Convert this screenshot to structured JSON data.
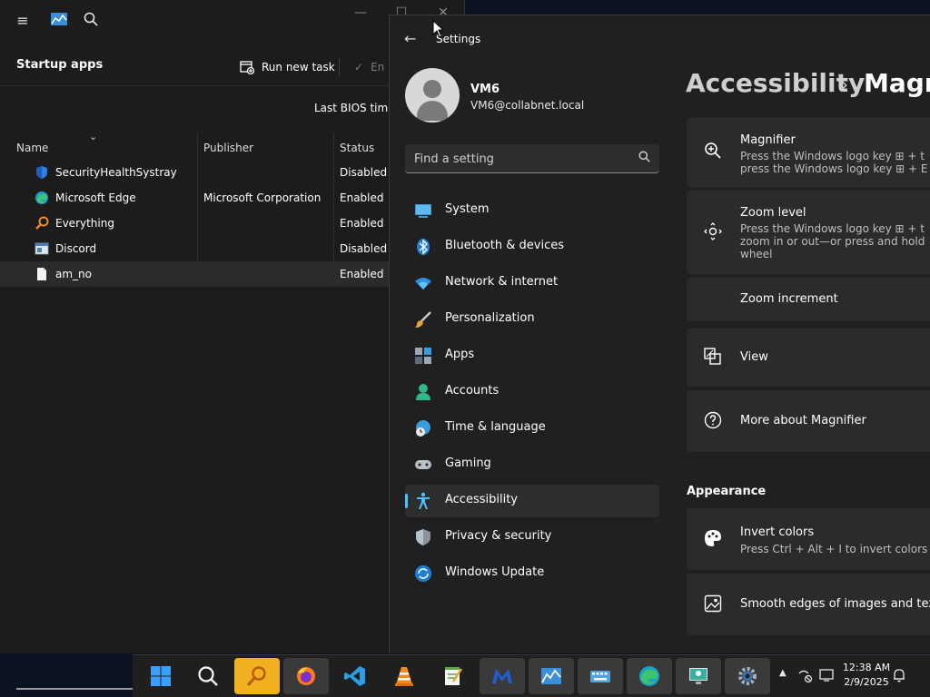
{
  "task_manager": {
    "page_title": "Startup apps",
    "run_new_task": "Run new task",
    "end_task": "En",
    "last_bios": "Last BIOS time:",
    "columns": [
      "Name",
      "Publisher",
      "Status"
    ],
    "rows": [
      {
        "name": "SecurityHealthSystray",
        "publisher": "",
        "status": "Disabled",
        "icon": "shield-icon"
      },
      {
        "name": "Microsoft Edge",
        "publisher": "Microsoft Corporation",
        "status": "Enabled",
        "icon": "edge-icon"
      },
      {
        "name": "Everything",
        "publisher": "",
        "status": "Enabled",
        "icon": "magnifier-icon"
      },
      {
        "name": "Discord",
        "publisher": "",
        "status": "Disabled",
        "icon": "window-icon"
      },
      {
        "name": "am_no",
        "publisher": "",
        "status": "Enabled",
        "icon": "file-icon"
      }
    ]
  },
  "settings": {
    "app_title": "Settings",
    "user": {
      "name": "VM6",
      "email": "VM6@collabnet.local"
    },
    "search_placeholder": "Find a setting",
    "nav": [
      {
        "label": "System",
        "icon": "system-icon"
      },
      {
        "label": "Bluetooth & devices",
        "icon": "bluetooth-icon"
      },
      {
        "label": "Network & internet",
        "icon": "wifi-icon"
      },
      {
        "label": "Personalization",
        "icon": "brush-icon"
      },
      {
        "label": "Apps",
        "icon": "apps-icon"
      },
      {
        "label": "Accounts",
        "icon": "person-icon"
      },
      {
        "label": "Time & language",
        "icon": "clock-globe-icon"
      },
      {
        "label": "Gaming",
        "icon": "gamepad-icon"
      },
      {
        "label": "Accessibility",
        "icon": "accessibility-icon",
        "active": true
      },
      {
        "label": "Privacy & security",
        "icon": "shield-icon"
      },
      {
        "label": "Windows Update",
        "icon": "update-icon"
      }
    ],
    "breadcrumb": {
      "parent": "Accessibility",
      "separator": "›",
      "current": "Magn"
    },
    "cards": {
      "magnifier": {
        "title": "Magnifier",
        "desc1": "Press the Windows logo key ⊞ + t",
        "desc2": "press the Windows logo key ⊞ + E"
      },
      "zoom_level": {
        "title": "Zoom level",
        "desc1": "Press the Windows logo key ⊞ + t",
        "desc2": "zoom in or out—or press and hold",
        "desc3": "wheel"
      },
      "zoom_increment": {
        "title": "Zoom increment"
      },
      "view": {
        "title": "View"
      },
      "more_about": {
        "title": "More about Magnifier"
      },
      "invert": {
        "title": "Invert colors",
        "desc": "Press Ctrl + Alt + I to invert colors"
      },
      "smooth": {
        "title": "Smooth edges of images and text"
      }
    },
    "section_appearance": "Appearance"
  },
  "taskbar": {
    "time": "12:38 AM",
    "date": "2/9/2025",
    "tray_chevron": "▲"
  },
  "colors": {
    "accent": "#4cc2ff",
    "yellow_app": "#f0b020"
  }
}
